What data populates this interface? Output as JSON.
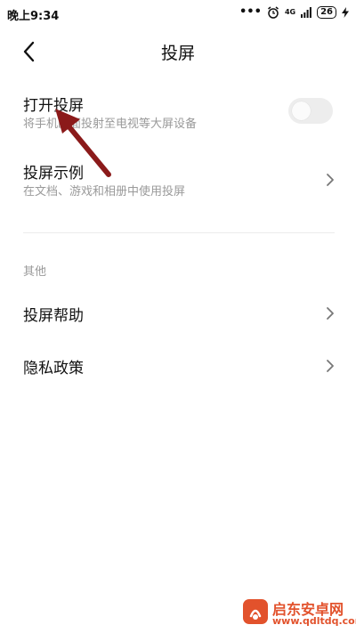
{
  "status_bar": {
    "time": "晚上9:34",
    "network": "4G",
    "battery": "26"
  },
  "header": {
    "title": "投屏"
  },
  "settings": {
    "enable_cast": {
      "label": "打开投屏",
      "description": "将手机画面投射至电视等大屏设备",
      "enabled": false
    },
    "cast_examples": {
      "label": "投屏示例",
      "description": "在文档、游戏和相册中使用投屏"
    }
  },
  "other_section": {
    "title": "其他",
    "items": [
      {
        "label": "投屏帮助"
      },
      {
        "label": "隐私政策"
      }
    ]
  },
  "watermark": {
    "brand": "启东安卓网",
    "url": "www.qdltdq.com"
  },
  "colors": {
    "arrow": "#8b1a1a",
    "toggle_off": "#ededed",
    "watermark": "#e2522c"
  }
}
